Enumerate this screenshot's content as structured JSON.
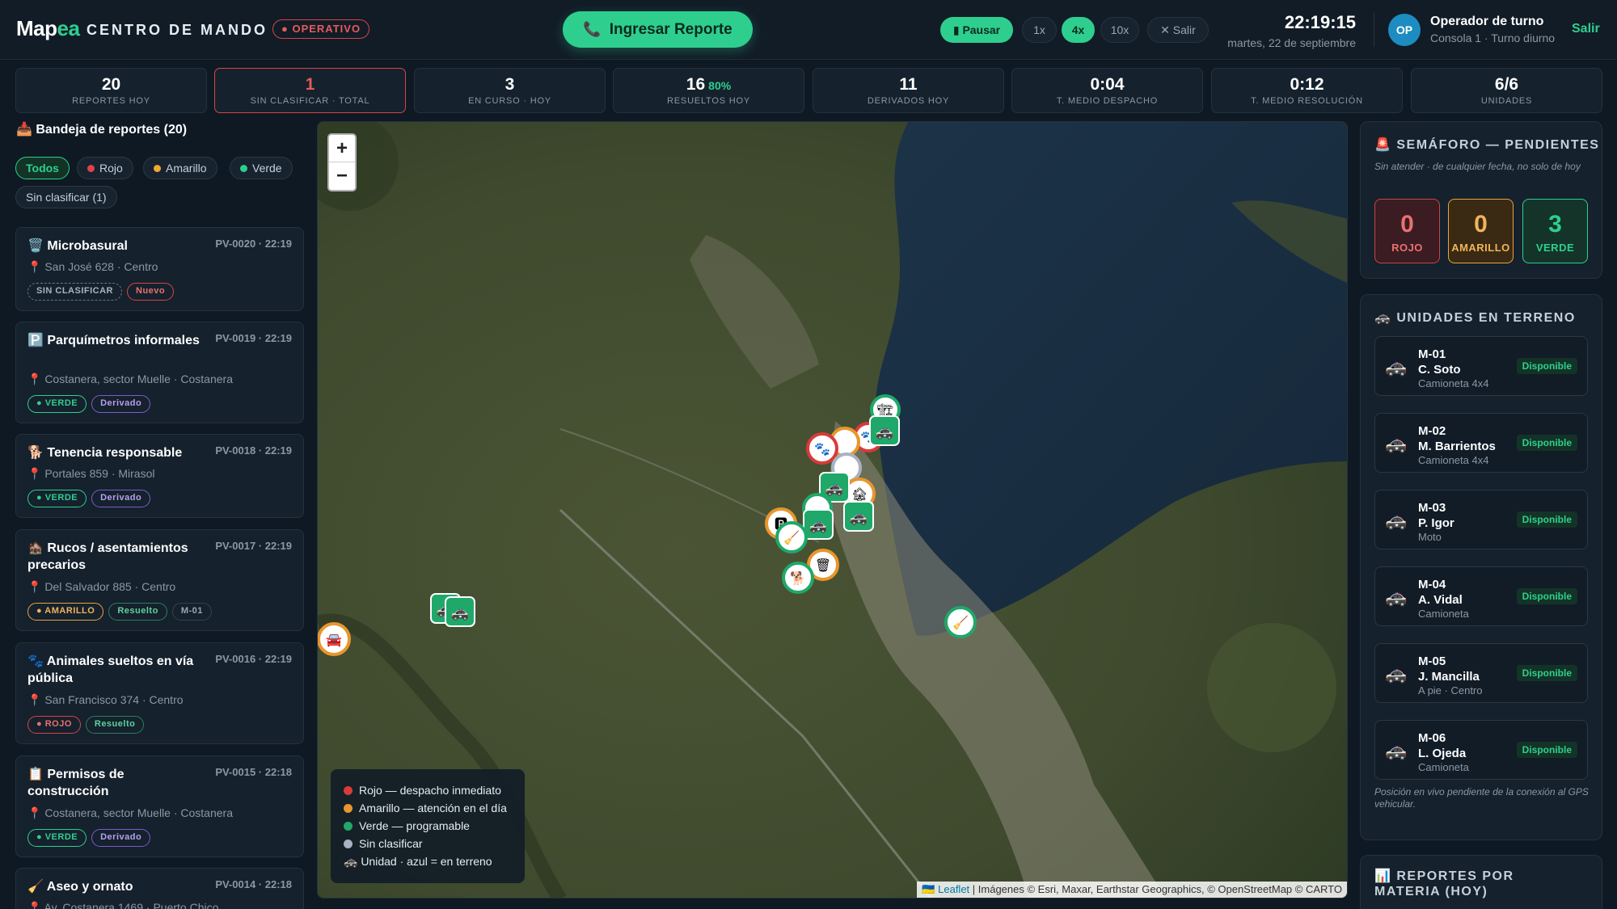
{
  "header": {
    "logo_main": "Map",
    "logo_accent": "ea",
    "title": "CENTRO DE MANDO",
    "status": "● OPERATIVO",
    "report_button": "Ingresar Reporte",
    "controls": {
      "pause": "▮ Pausar",
      "speeds": [
        "1x",
        "4x",
        "10x"
      ],
      "active_speed": "4x",
      "exit": "✕ Salir"
    },
    "time": "22:19:15",
    "date": "martes, 22 de septiembre",
    "operator": {
      "initials": "OP",
      "name": "Operador de turno",
      "sub": "Consola 1 · Turno diurno"
    },
    "logout": "Salir"
  },
  "stats": [
    {
      "value": "20",
      "label": "REPORTES HOY"
    },
    {
      "value": "1",
      "label": "SIN CLASIFICAR · TOTAL",
      "highlight": true
    },
    {
      "value": "3",
      "label": "EN CURSO · HOY"
    },
    {
      "value": "16",
      "pct": "80%",
      "label": "RESUELTOS HOY"
    },
    {
      "value": "11",
      "label": "DERIVADOS HOY"
    },
    {
      "value": "0:04",
      "label": "T. MEDIO DESPACHO"
    },
    {
      "value": "0:12",
      "label": "T. MEDIO RESOLUCIÓN"
    },
    {
      "value": "6/6",
      "label": "UNIDADES"
    }
  ],
  "inbox": {
    "title": "📥 Bandeja de reportes (20)",
    "filters": {
      "all": "Todos",
      "rojo": "Rojo",
      "amarillo": "Amarillo",
      "verde": "Verde",
      "unclassified": "Sin clasificar (1)"
    },
    "reports": [
      {
        "icon": "🗑️",
        "title": "Microbasural",
        "id": "PV-0020 · 22:19",
        "address": "📍 San José 628 · Centro",
        "tags": [
          {
            "text": "SIN CLASIFICAR",
            "kind": "unclass"
          },
          {
            "text": "Nuevo",
            "kind": "nuevo"
          }
        ]
      },
      {
        "icon": "🅿️",
        "title": "Parquímetros informales",
        "id": "PV-0019 · 22:19",
        "address": "📍 Costanera, sector Muelle · Costanera",
        "tags": [
          {
            "text": "● VERDE",
            "kind": "verde"
          },
          {
            "text": "Derivado",
            "kind": "derivado"
          }
        ]
      },
      {
        "icon": "🐕",
        "title": "Tenencia responsable",
        "id": "PV-0018 · 22:19",
        "address": "📍 Portales 859 · Mirasol",
        "tags": [
          {
            "text": "● VERDE",
            "kind": "verde"
          },
          {
            "text": "Derivado",
            "kind": "derivado"
          }
        ]
      },
      {
        "icon": "🏚️",
        "title": "Rucos / asentamientos precarios",
        "id": "PV-0017 · 22:19",
        "address": "📍 Del Salvador 885 · Centro",
        "tags": [
          {
            "text": "● AMARILLO",
            "kind": "amarillo"
          },
          {
            "text": "Resuelto",
            "kind": "resuelto"
          },
          {
            "text": "M-01",
            "kind": "unit"
          }
        ]
      },
      {
        "icon": "🐾",
        "title": "Animales sueltos en vía pública",
        "id": "PV-0016 · 22:19",
        "address": "📍 San Francisco 374 · Centro",
        "tags": [
          {
            "text": "● ROJO",
            "kind": "rojo"
          },
          {
            "text": "Resuelto",
            "kind": "resuelto"
          }
        ]
      },
      {
        "icon": "📋",
        "title": "Permisos de construcción",
        "id": "PV-0015 · 22:18",
        "address": "📍 Costanera, sector Muelle · Costanera",
        "tags": [
          {
            "text": "● VERDE",
            "kind": "verde"
          },
          {
            "text": "Derivado",
            "kind": "derivado"
          }
        ]
      },
      {
        "icon": "🧹",
        "title": "Aseo y ornato",
        "id": "PV-0014 · 22:18",
        "address": "📍 Av. Costanera 1469 · Puerto Chico",
        "tags": []
      }
    ]
  },
  "map": {
    "zoom_in": "+",
    "zoom_out": "−",
    "legend": [
      {
        "text": "Rojo — despacho inmediato",
        "color": "#d93a3a"
      },
      {
        "text": "Amarillo — atención en el día",
        "color": "#e8962d"
      },
      {
        "text": "Verde — programable",
        "color": "#1fa86a"
      },
      {
        "text": "Sin clasificar",
        "color": "#a7b3c2"
      },
      {
        "text": "🚓 Unidad · azul = en terreno",
        "color": ""
      }
    ],
    "attribution_link": "🇺🇦 Leaflet",
    "attribution_text": " | Imágenes © Esri, Maxar, Earthstar Geographics, © OpenStreetMap © CARTO"
  },
  "semaforo": {
    "title": "🚨 SEMÁFORO — PENDIENTES",
    "note": "Sin atender · de cualquier fecha, no solo de hoy",
    "rojo": {
      "value": "0",
      "label": "ROJO"
    },
    "amarillo": {
      "value": "0",
      "label": "AMARILLO"
    },
    "verde": {
      "value": "3",
      "label": "VERDE"
    }
  },
  "units": {
    "title": "🚓 UNIDADES EN TERRENO",
    "items": [
      {
        "code": "M-01",
        "name": "C. Soto",
        "type": "Camioneta 4x4",
        "status": "Disponible"
      },
      {
        "code": "M-02",
        "name": "M. Barrientos",
        "type": "Camioneta 4x4",
        "status": "Disponible"
      },
      {
        "code": "M-03",
        "name": "P. Igor",
        "type": "Moto",
        "status": "Disponible"
      },
      {
        "code": "M-04",
        "name": "A. Vidal",
        "type": "Camioneta",
        "status": "Disponible"
      },
      {
        "code": "M-05",
        "name": "J. Mancilla",
        "type": "A pie · Centro",
        "status": "Disponible"
      },
      {
        "code": "M-06",
        "name": "L. Ojeda",
        "type": "Camioneta",
        "status": "Disponible"
      }
    ],
    "note": "Posición en vivo pendiente de la conexión al GPS vehicular."
  },
  "materia": {
    "title": "📊 REPORTES POR MATERIA (HOY)"
  },
  "colors": {
    "accent": "#2ecf8e",
    "alert": "#d64545",
    "background": "#0f1923",
    "panel": "#15212d"
  }
}
